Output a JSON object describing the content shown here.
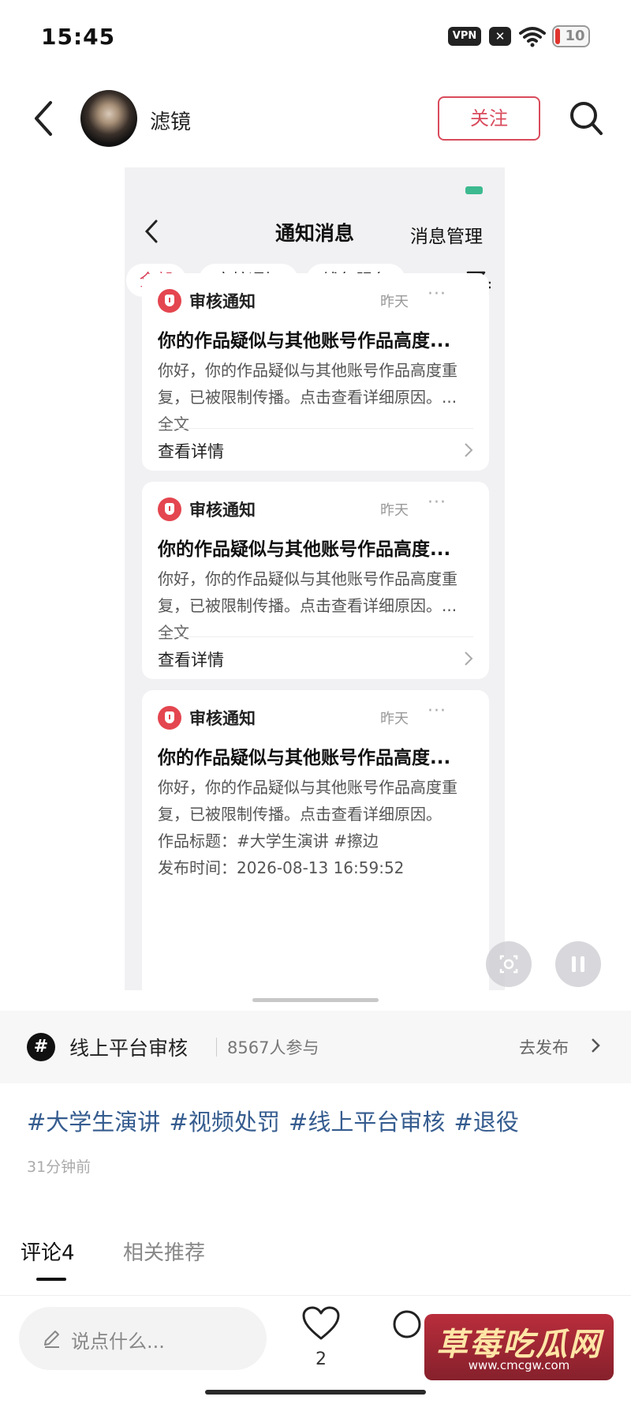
{
  "status_bar": {
    "time": "15:45",
    "vpn_label": "VPN",
    "x_label": "✕",
    "battery": "10"
  },
  "header": {
    "username": "滤镜",
    "follow_label": "关注"
  },
  "screenshot": {
    "title": "通知消息",
    "manage_label": "消息管理",
    "chips": [
      "全部",
      "审核通知",
      "钱包服务"
    ],
    "cards": [
      {
        "type": "审核通知",
        "time": "昨天",
        "more": "···",
        "title": "你的作品疑似与其他账号作品高度...",
        "body": "你好，你的作品疑似与其他账号作品高度重复，已被限制传播。点击查看详细原因。...",
        "fulltext": "全文",
        "detail": "查看详情"
      },
      {
        "type": "审核通知",
        "time": "昨天",
        "more": "···",
        "title": "你的作品疑似与其他账号作品高度...",
        "body": "你好，你的作品疑似与其他账号作品高度重复，已被限制传播。点击查看详细原因。...",
        "fulltext": "全文",
        "detail": "查看详情"
      },
      {
        "type": "审核通知",
        "time": "昨天",
        "more": "···",
        "title": "你的作品疑似与其他账号作品高度...",
        "body": "你好，你的作品疑似与其他账号作品高度重复，已被限制传播。点击查看详细原因。",
        "work_title_line": "作品标题：#大学生演讲 #擦边",
        "publish_time_line": "发布时间：2026-08-13 16:59:52"
      }
    ]
  },
  "topic": {
    "icon": "#",
    "name": "线上平台审核",
    "count": "8567人参与",
    "publish_label": "去发布"
  },
  "post": {
    "hashtags": "#大学生演讲 #视频处罚 #线上平台审核 #退役",
    "time": "31分钟前"
  },
  "tabs": {
    "comments": "评论4",
    "related": "相关推荐"
  },
  "bottom_bar": {
    "comment_placeholder": "说点什么...",
    "like_count": "2"
  },
  "watermark": {
    "text": "草莓吃瓜网",
    "url": "www.cmcgw.com"
  }
}
